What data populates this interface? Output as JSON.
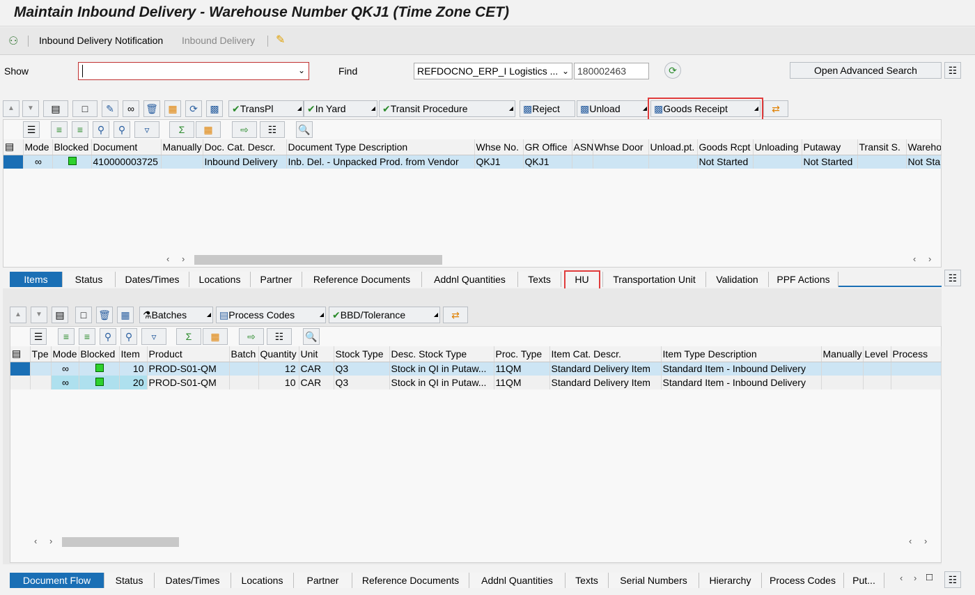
{
  "title": "Maintain Inbound Delivery - Warehouse Number QKJ1 (Time Zone CET)",
  "menu": {
    "item1": "Inbound Delivery Notification",
    "item2": "Inbound Delivery"
  },
  "search": {
    "show_label": "Show",
    "show_value": "",
    "find_label": "Find",
    "find_select": "REFDOCNO_ERP_I Logistics ...",
    "find_value": "180002463",
    "advanced": "Open Advanced Search"
  },
  "toolbar1": {
    "transpl": "TransPl",
    "in_yard": "In Yard",
    "transit": "Transit Procedure",
    "reject": "Reject",
    "unload": "Unload",
    "goods_receipt": "Goods Receipt"
  },
  "header_grid": {
    "columns": [
      "Mode",
      "Blocked",
      "Document",
      "Manually",
      "Doc. Cat. Descr.",
      "Document Type Description",
      "Whse No.",
      "GR Office",
      "ASN",
      "Whse Door",
      "Unload.pt.",
      "Goods Rcpt",
      "Unloading",
      "Putaway",
      "Transit S.",
      "Wareho"
    ],
    "row": {
      "document": "410000003725",
      "doc_cat": "Inbound Delivery",
      "doc_type": "Inb. Del. - Unpacked Prod. from Vendor",
      "whse": "QKJ1",
      "gr_office": "QKJ1",
      "goods_rcpt": "Not Started",
      "putaway": "Not Started",
      "wareho": "Not Sta"
    }
  },
  "tabs1": [
    "Items",
    "Status",
    "Dates/Times",
    "Locations",
    "Partner",
    "Reference Documents",
    "Addnl Quantities",
    "Texts",
    "HU",
    "Transportation Unit",
    "Validation",
    "PPF Actions"
  ],
  "toolbar2": {
    "batches": "Batches",
    "process_codes": "Process Codes",
    "bbd": "BBD/Tolerance"
  },
  "items_grid": {
    "columns": [
      "Tpe",
      "Mode",
      "Blocked",
      "Item",
      "Product",
      "Batch",
      "Quantity",
      "Unit",
      "Stock Type",
      "Desc. Stock Type",
      "Proc. Type",
      "Item Cat. Descr.",
      "Item Type Description",
      "Manually",
      "Level",
      "Process"
    ],
    "rows": [
      {
        "item": "10",
        "product": "PROD-S01-QM",
        "quantity": "12",
        "unit": "CAR",
        "stock_type": "Q3",
        "desc_stock": "Stock in QI in Putaw...",
        "proc_type": "11QM",
        "item_cat": "Standard Delivery Item",
        "item_type": "Standard Item - Inbound Delivery"
      },
      {
        "item": "20",
        "product": "PROD-S01-QM",
        "quantity": "10",
        "unit": "CAR",
        "stock_type": "Q3",
        "desc_stock": "Stock in QI in Putaw...",
        "proc_type": "11QM",
        "item_cat": "Standard Delivery Item",
        "item_type": "Standard Item - Inbound Delivery"
      }
    ]
  },
  "tabs2": [
    "Document Flow",
    "Status",
    "Dates/Times",
    "Locations",
    "Partner",
    "Reference Documents",
    "Addnl Quantities",
    "Texts",
    "Serial Numbers",
    "Hierarchy",
    "Process Codes",
    "Put..."
  ],
  "colors": {
    "accent": "#1a6fb5",
    "highlight": "#e03c3c",
    "selection": "#cde5f4",
    "status_green": "#2ed12e"
  }
}
